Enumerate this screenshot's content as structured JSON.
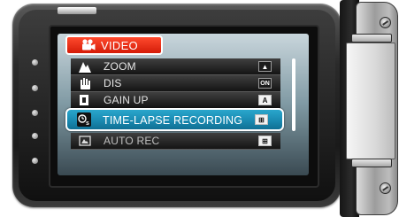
{
  "menu": {
    "title": "VIDEO",
    "title_icon": "movie-camera-icon",
    "items": [
      {
        "label": "ZOOM",
        "icon": "zoom-icon",
        "value": "▲",
        "selected": false
      },
      {
        "label": "DIS",
        "icon": "dis-hand-icon",
        "value": "ON",
        "selected": false
      },
      {
        "label": "GAIN UP",
        "icon": "gain-up-icon",
        "value": "A",
        "selected": false
      },
      {
        "label": "TIME-LAPSE RECORDING",
        "icon": "time-lapse-icon",
        "value": "⊞",
        "selected": true
      },
      {
        "label": "AUTO REC",
        "icon": "auto-rec-icon",
        "value": "⊞",
        "selected": false
      }
    ]
  },
  "colors": {
    "header_red": "#e52a12",
    "selection_blue": "#1a8ab1",
    "menu_background_top": "#c9d6dc",
    "camera_body": "#2a2a2a"
  }
}
